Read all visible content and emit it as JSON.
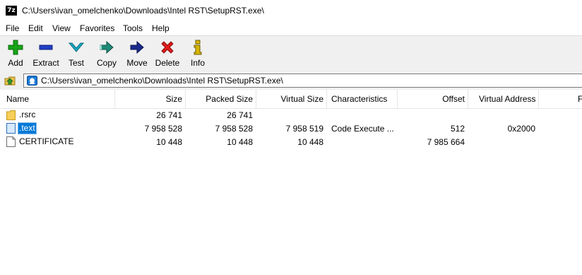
{
  "window": {
    "title": "C:\\Users\\ivan_omelchenko\\Downloads\\Intel RST\\SetupRST.exe\\",
    "app_icon_text": "7z"
  },
  "menu": [
    "File",
    "Edit",
    "View",
    "Favorites",
    "Tools",
    "Help"
  ],
  "toolbar": [
    {
      "label": "Add",
      "icon": "plus-icon",
      "color": "#16a316"
    },
    {
      "label": "Extract",
      "icon": "minus-icon",
      "color": "#1f3fc4"
    },
    {
      "label": "Test",
      "icon": "checkmark-chevron-icon",
      "color": "#1aa9c4"
    },
    {
      "label": "Copy",
      "icon": "copy-arrow-icon",
      "color": "#1e8a78"
    },
    {
      "label": "Move",
      "icon": "move-arrow-icon",
      "color": "#1a2a8c"
    },
    {
      "label": "Delete",
      "icon": "delete-x-icon",
      "color": "#e01b1b"
    },
    {
      "label": "Info",
      "icon": "info-icon",
      "color": "#d8b800"
    }
  ],
  "address": {
    "path": "C:\\Users\\ivan_omelchenko\\Downloads\\Intel RST\\SetupRST.exe\\",
    "up_icon": "folder-up-icon",
    "path_icon": "archive-icon"
  },
  "columns": [
    "Name",
    "Size",
    "Packed Size",
    "Virtual Size",
    "Characteristics",
    "Offset",
    "Virtual Address",
    "F"
  ],
  "rows": [
    {
      "name": ".rsrc",
      "icon": "folder-icon",
      "size": "26 741",
      "packed": "26 741",
      "virtual_size": "",
      "characteristics": "",
      "offset": "",
      "virtual_address": "",
      "selected": false
    },
    {
      "name": ".text",
      "icon": "file-icon",
      "size": "7 958 528",
      "packed": "7 958 528",
      "virtual_size": "7 958 519",
      "characteristics": "Code Execute ...",
      "offset": "512",
      "virtual_address": "0x2000",
      "selected": true
    },
    {
      "name": "CERTIFICATE",
      "icon": "file-icon",
      "size": "10 448",
      "packed": "10 448",
      "virtual_size": "10 448",
      "characteristics": "",
      "offset": "7 985 664",
      "virtual_address": "",
      "selected": false
    }
  ],
  "colors": {
    "selection": "#0078d7",
    "toolbar_bg": "#f0f0f0",
    "folder": "#f6cf5a"
  }
}
